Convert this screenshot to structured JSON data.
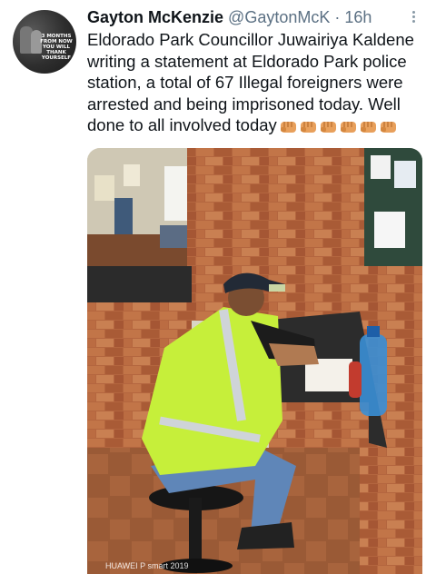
{
  "tweet": {
    "author_name": "Gayton McKenzie",
    "handle": "@GaytonMcK",
    "separator": "·",
    "time": "16h",
    "text": "Eldorado Park Councillor Juwairiya Kaldene writing a statement at Eldorado Park police station, a total of 67 Illegal foreigners were arrested and being imprisoned today. Well done to all involved today",
    "emoji": [
      "raised-fist-icon",
      "raised-fist-icon",
      "raised-fist-icon",
      "raised-fist-icon",
      "raised-fist-icon",
      "raised-fist-icon"
    ]
  },
  "avatar": {
    "text": "3 MONTHS FROM NOW YOU WILL THANK YOURSELF"
  },
  "media": {
    "watermark": "HUAWEI P smart 2019"
  },
  "colors": {
    "text": "#0f1419",
    "secondary": "#5b7083",
    "vest": "#c6ef3a",
    "brick": "#b0603a"
  }
}
